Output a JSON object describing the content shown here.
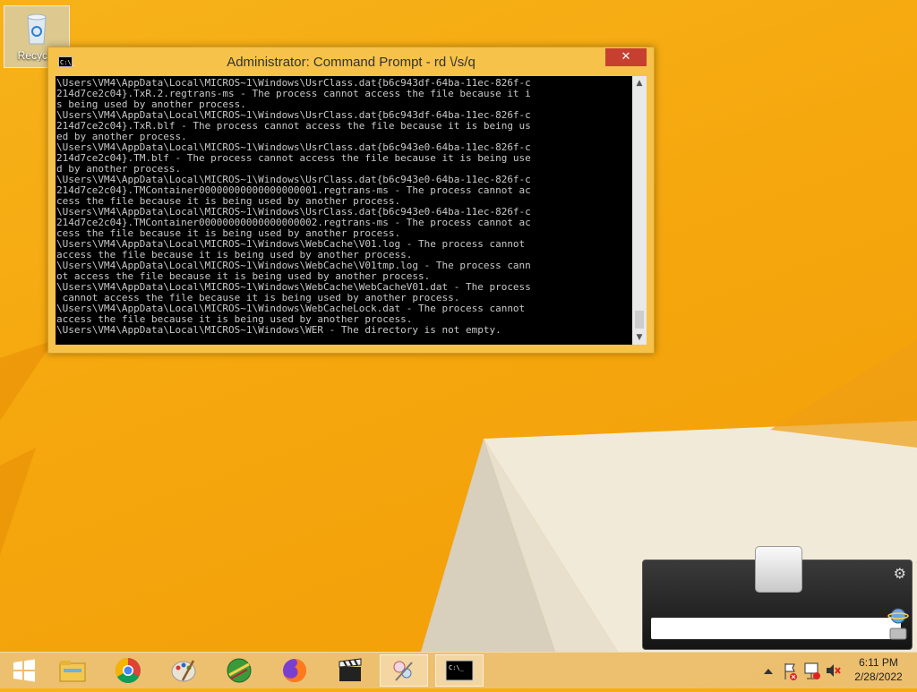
{
  "desktop": {
    "recycle_bin_label": "Recycle"
  },
  "cmd_window": {
    "title": "Administrator: Command Prompt - rd \\/s/q",
    "close_glyph": "✕",
    "app_icon_text": "C:\\_",
    "console_lines": [
      "\\Users\\VM4\\AppData\\Local\\MICROS~1\\Windows\\UsrClass.dat{b6c943df-64ba-11ec-826f-c",
      "214d7ce2c04}.TxR.2.regtrans-ms - The process cannot access the file because it i",
      "s being used by another process.",
      "\\Users\\VM4\\AppData\\Local\\MICROS~1\\Windows\\UsrClass.dat{b6c943df-64ba-11ec-826f-c",
      "214d7ce2c04}.TxR.blf - The process cannot access the file because it is being us",
      "ed by another process.",
      "\\Users\\VM4\\AppData\\Local\\MICROS~1\\Windows\\UsrClass.dat{b6c943e0-64ba-11ec-826f-c",
      "214d7ce2c04}.TM.blf - The process cannot access the file because it is being use",
      "d by another process.",
      "\\Users\\VM4\\AppData\\Local\\MICROS~1\\Windows\\UsrClass.dat{b6c943e0-64ba-11ec-826f-c",
      "214d7ce2c04}.TMContainer00000000000000000001.regtrans-ms - The process cannot ac",
      "cess the file because it is being used by another process.",
      "\\Users\\VM4\\AppData\\Local\\MICROS~1\\Windows\\UsrClass.dat{b6c943e0-64ba-11ec-826f-c",
      "214d7ce2c04}.TMContainer00000000000000000002.regtrans-ms - The process cannot ac",
      "cess the file because it is being used by another process.",
      "\\Users\\VM4\\AppData\\Local\\MICROS~1\\Windows\\WebCache\\V01.log - The process cannot",
      "access the file because it is being used by another process.",
      "\\Users\\VM4\\AppData\\Local\\MICROS~1\\Windows\\WebCache\\V01tmp.log - The process cann",
      "ot access the file because it is being used by another process.",
      "\\Users\\VM4\\AppData\\Local\\MICROS~1\\Windows\\WebCache\\WebCacheV01.dat - The process",
      " cannot access the file because it is being used by another process.",
      "\\Users\\VM4\\AppData\\Local\\MICROS~1\\Windows\\WebCacheLock.dat - The process cannot",
      "access the file because it is being used by another process.",
      "\\Users\\VM4\\AppData\\Local\\MICROS~1\\Windows\\WER - The directory is not empty."
    ]
  },
  "taskbar": {
    "items": [
      {
        "name": "start-button",
        "icon": "windows-logo-icon"
      },
      {
        "name": "taskbar-file-explorer",
        "icon": "folder-icon"
      },
      {
        "name": "taskbar-chrome",
        "icon": "chrome-icon"
      },
      {
        "name": "taskbar-paint",
        "icon": "palette-icon"
      },
      {
        "name": "taskbar-app-green",
        "icon": "green-globe-icon"
      },
      {
        "name": "taskbar-firefox",
        "icon": "firefox-icon"
      },
      {
        "name": "taskbar-media",
        "icon": "clapperboard-icon"
      },
      {
        "name": "taskbar-snipping",
        "icon": "scissors-icon"
      },
      {
        "name": "taskbar-cmd",
        "icon": "console-icon"
      }
    ],
    "clock": {
      "time": "6:11 PM",
      "date": "2/28/2022"
    }
  },
  "colors": {
    "wallpaper": "#f5a70d",
    "cmd_frame": "#f6c24a",
    "close_button": "#c7402f",
    "console_bg": "#000000",
    "console_text": "#c8c8c8"
  }
}
